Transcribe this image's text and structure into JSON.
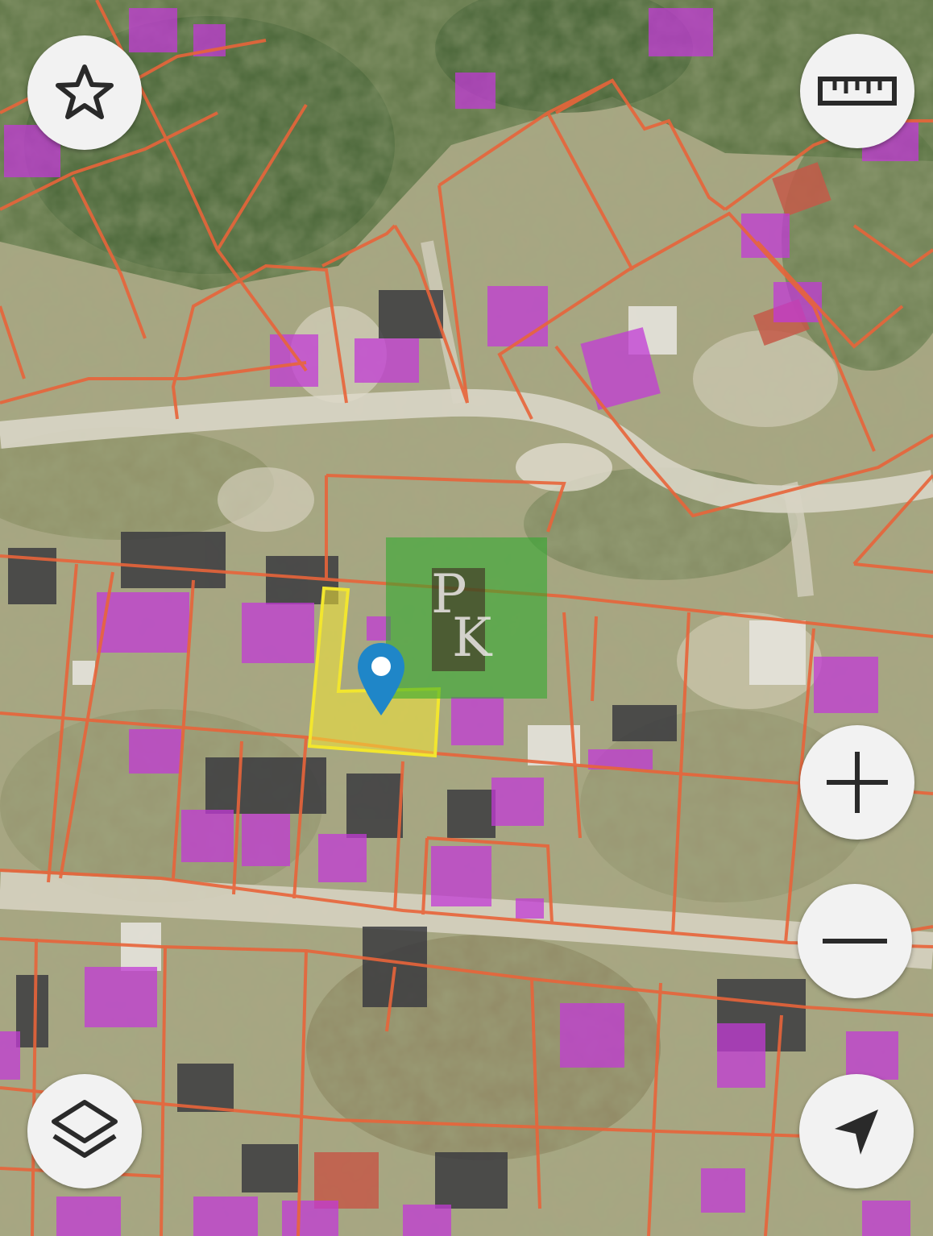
{
  "map": {
    "type": "satellite-cadastral",
    "parcel_outline_color": "#e8643a",
    "building_footprint_color": "#c23ad6",
    "selected_parcel_color": "#f2e62e",
    "pin_color": "#1f86c8"
  },
  "watermark": {
    "line1": "P",
    "line2": "K"
  },
  "controls": {
    "favorite": {
      "icon": "star-icon"
    },
    "ruler": {
      "icon": "ruler-icon"
    },
    "zoom_in": {
      "icon": "plus-icon"
    },
    "zoom_out": {
      "icon": "minus-icon"
    },
    "layers": {
      "icon": "layers-icon"
    },
    "locate": {
      "icon": "navigation-arrow-icon"
    }
  }
}
